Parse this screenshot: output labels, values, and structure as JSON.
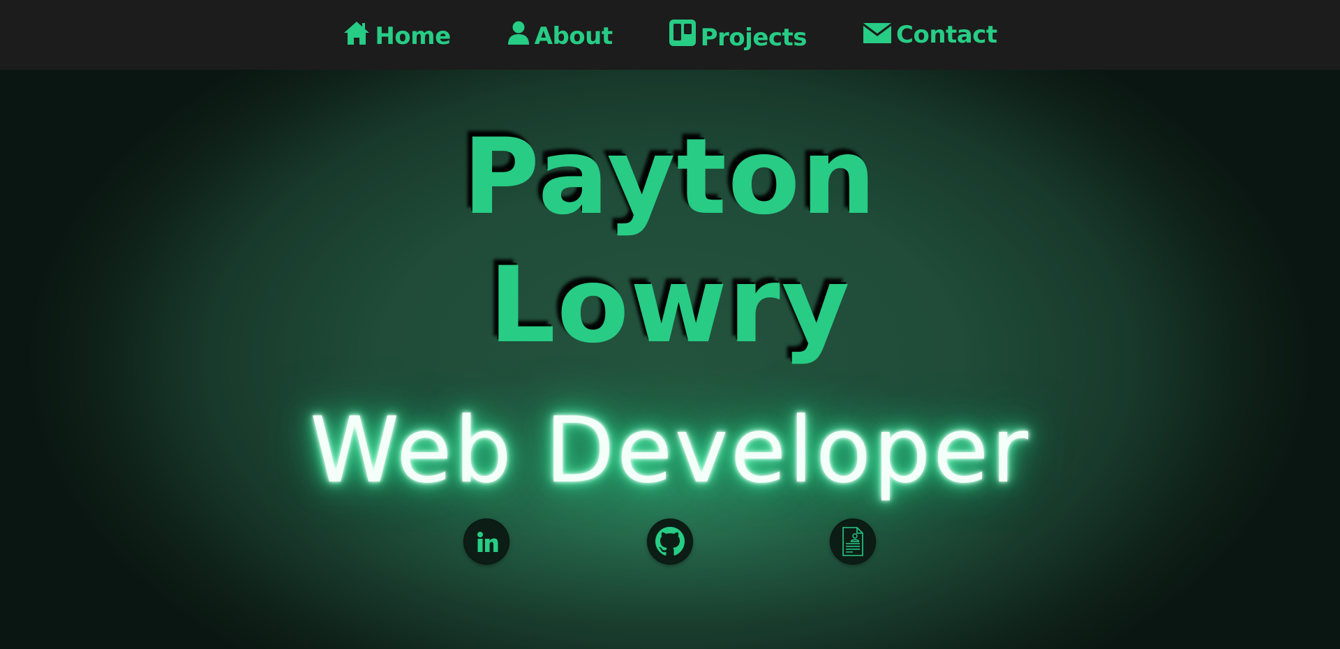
{
  "nav": {
    "items": [
      {
        "label": "Home",
        "icon": "home-icon"
      },
      {
        "label": "About",
        "icon": "user-icon"
      },
      {
        "label": "Projects",
        "icon": "projects-board-icon"
      },
      {
        "label": "Contact",
        "icon": "envelope-icon"
      }
    ]
  },
  "hero": {
    "first_name": "Payton",
    "last_name": "Lowry",
    "role": "Web Developer"
  },
  "social": [
    {
      "icon": "linkedin-icon"
    },
    {
      "icon": "github-icon"
    },
    {
      "icon": "resume-icon"
    }
  ],
  "colors": {
    "accent": "#27cc85",
    "navbar_bg": "#1c1c1c",
    "hero_bg": "#204c39",
    "role_text": "#f4fffa",
    "social_bg": "#0c1d16"
  }
}
